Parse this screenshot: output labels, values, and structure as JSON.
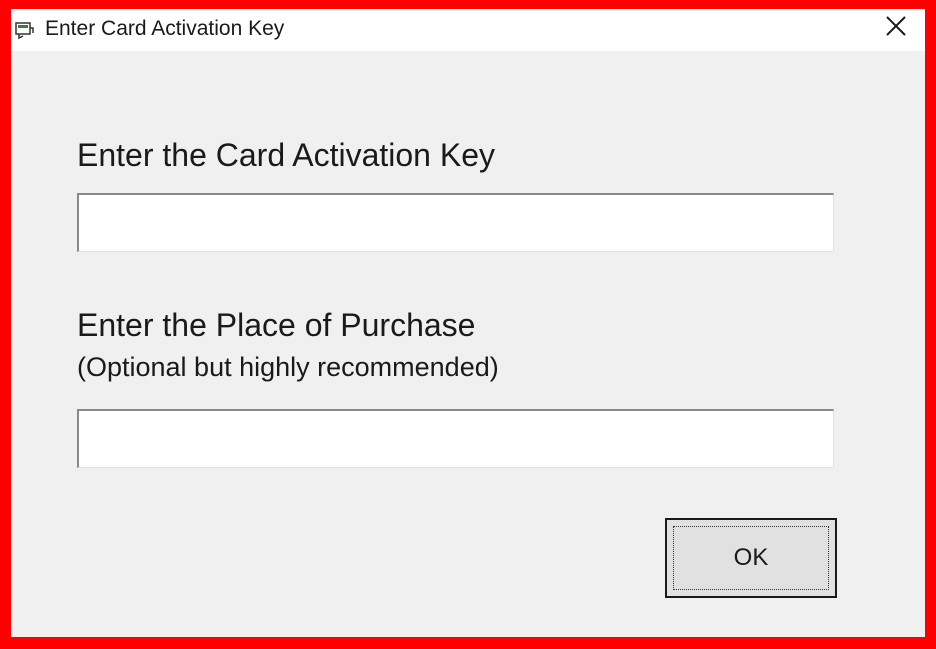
{
  "window": {
    "title": "Enter Card Activation Key",
    "icon": "card-app-icon",
    "close_icon": "close-icon"
  },
  "form": {
    "activation_key_label": "Enter the Card Activation Key",
    "activation_key_value": "",
    "place_of_purchase_label": "Enter the Place of Purchase",
    "place_of_purchase_note": "(Optional but highly recommended)",
    "place_of_purchase_value": "",
    "ok_label": "OK"
  },
  "colors": {
    "highlight_border": "#ff0000",
    "dialog_background": "#f0f0f0",
    "titlebar_background": "#ffffff"
  }
}
